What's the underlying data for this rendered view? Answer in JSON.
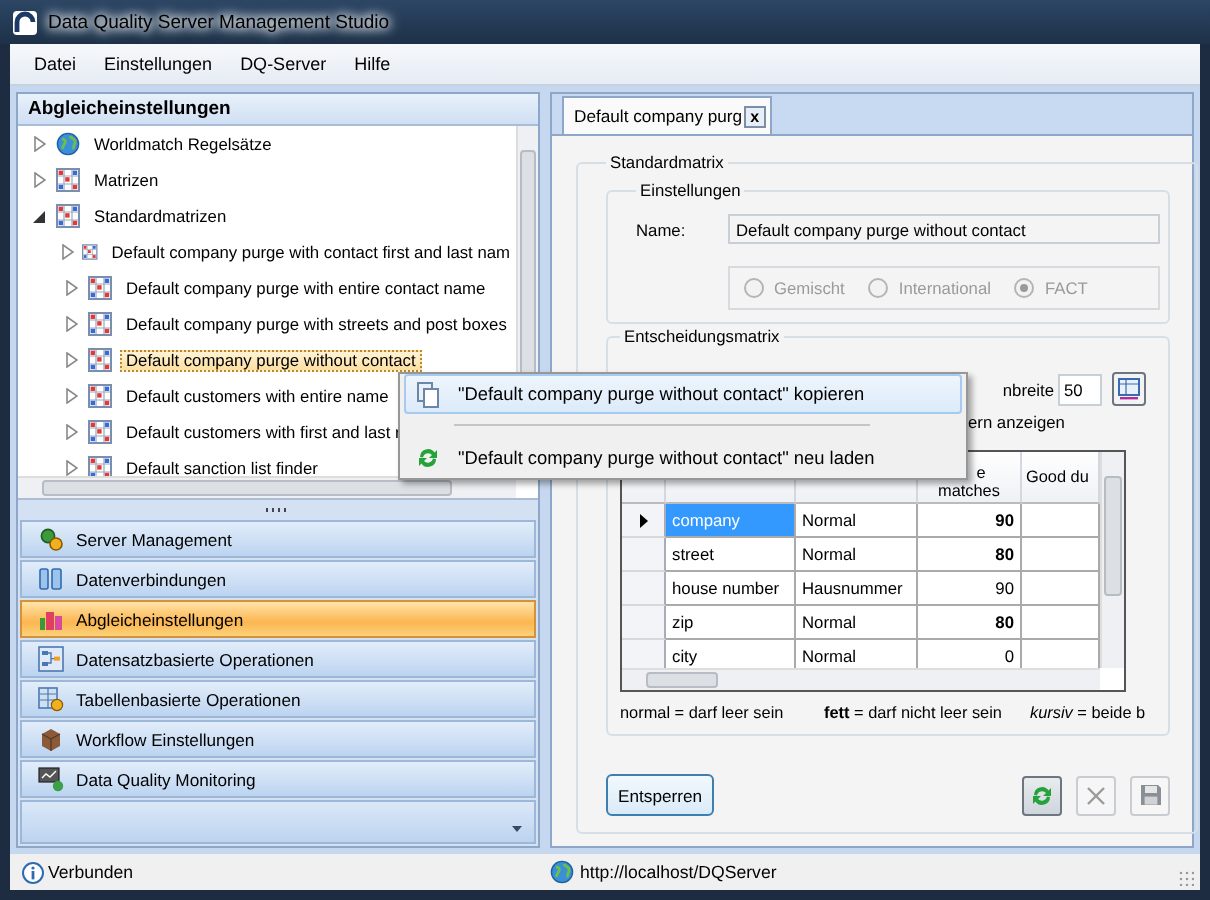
{
  "window": {
    "title": "Data Quality Server Management Studio"
  },
  "menu_bar": [
    "Datei",
    "Einstellungen",
    "DQ-Server",
    "Hilfe"
  ],
  "left_panel": {
    "title": "Abgleicheinstellungen",
    "tree": [
      {
        "label": "Worldmatch Regelsätze",
        "kind": "globe",
        "expanded": false,
        "selected": false
      },
      {
        "label": "Matrizen",
        "kind": "matrix",
        "expanded": false,
        "selected": false
      },
      {
        "label": "Standardmatrizen",
        "kind": "matrix",
        "expanded": true,
        "selected": false,
        "children": [
          {
            "label": "Default company purge with contact first and last nam",
            "kind": "matrix",
            "expanded": false,
            "selected": false
          },
          {
            "label": "Default company purge with entire contact name",
            "kind": "matrix",
            "expanded": false,
            "selected": false
          },
          {
            "label": "Default company purge with streets and post boxes",
            "kind": "matrix",
            "expanded": false,
            "selected": false
          },
          {
            "label": "Default company purge without contact",
            "kind": "matrix",
            "expanded": false,
            "selected": true
          },
          {
            "label": "Default customers with entire name",
            "kind": "matrix",
            "expanded": false,
            "selected": false
          },
          {
            "label": "Default customers with first and last r",
            "kind": "matrix",
            "expanded": false,
            "selected": false
          },
          {
            "label": "Default sanction list finder",
            "kind": "matrix",
            "expanded": false,
            "selected": false
          }
        ]
      }
    ]
  },
  "navigation": [
    {
      "label": "Server Management",
      "selected": false
    },
    {
      "label": "Datenverbindungen",
      "selected": false
    },
    {
      "label": "Abgleicheinstellungen",
      "selected": true
    },
    {
      "label": "Datensatzbasierte Operationen",
      "selected": false
    },
    {
      "label": "Tabellenbasierte Operationen",
      "selected": false
    },
    {
      "label": "Workflow Einstellungen",
      "selected": false
    },
    {
      "label": "Data Quality Monitoring",
      "selected": false
    }
  ],
  "tab": {
    "label": "Default company purg",
    "close": "x",
    "selected": true
  },
  "standardmatrix": {
    "title": "Standardmatrix",
    "settings": {
      "title": "Einstellungen",
      "name_label": "Name:",
      "name_value": "Default company purge without contact",
      "options": [
        {
          "label": "Gemischt",
          "selected": false,
          "disabled": true
        },
        {
          "label": "International",
          "selected": false,
          "disabled": true
        },
        {
          "label": "FACT",
          "selected": true,
          "disabled": true
        }
      ]
    },
    "decision": {
      "title": "Entscheidungsmatrix",
      "width_label": "nbreite",
      "width_value": "50",
      "show_label": "ern anzeigen",
      "column_headers": {
        "score": [
          "e",
          "matches"
        ],
        "column_5": "Good du"
      },
      "rows": [
        {
          "name": "company",
          "type": "Normal",
          "score": "90",
          "bold": true,
          "selected": true
        },
        {
          "name": "street",
          "type": "Normal",
          "score": "80",
          "bold": true,
          "selected": false
        },
        {
          "name": "house number",
          "type": "Hausnummer",
          "score": "90",
          "bold": false,
          "selected": false
        },
        {
          "name": "zip",
          "type": "Normal",
          "score": "80",
          "bold": true,
          "selected": false
        },
        {
          "name": "city",
          "type": "Normal",
          "score": "0",
          "bold": false,
          "selected": false
        }
      ],
      "legend": [
        "normal = darf leer sein",
        "**fett** = darf nicht leer sein",
        "*kursiv* = beide b"
      ]
    },
    "unlock_button": "Entsperren",
    "tool_buttons": [
      {
        "kind": "refresh",
        "disabled": false
      },
      {
        "kind": "delete",
        "disabled": true
      },
      {
        "kind": "save",
        "disabled": true
      }
    ]
  },
  "context_menu": [
    {
      "kind": "copy",
      "label": "\"Default company purge without contact\" kopieren",
      "selected": true
    },
    {
      "kind": "separator"
    },
    {
      "kind": "reload",
      "label": "\"Default company purge without contact\" neu laden",
      "selected": false
    }
  ],
  "status_bar": {
    "connection": "Verbunden",
    "server": "http://localhost/DQServer"
  }
}
